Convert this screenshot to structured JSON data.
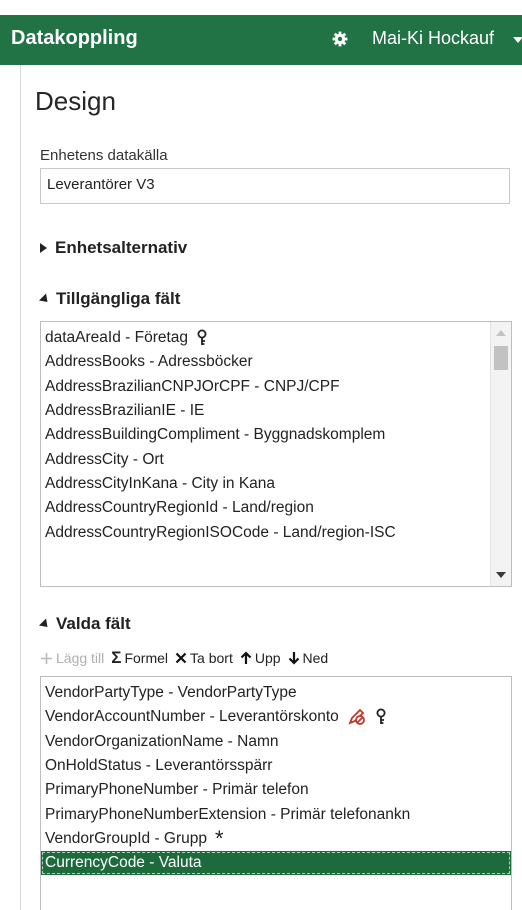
{
  "app": {
    "title": "Datakoppling",
    "user": "Mai-Ki Hockauf"
  },
  "page": {
    "heading": "Design"
  },
  "datasource": {
    "label": "Enhetens datakälla",
    "value": "Leverantörer V3"
  },
  "sections": {
    "entity_options": "Enhetsalternativ",
    "available_fields": "Tillgängliga fält",
    "selected_fields": "Valda fält"
  },
  "available_fields": [
    {
      "text": "dataAreaId - Företag",
      "icon": "key-icon"
    },
    {
      "text": "AddressBooks - Adressböcker"
    },
    {
      "text": "AddressBrazilianCNPJOrCPF - CNPJ/CPF"
    },
    {
      "text": "AddressBrazilianIE - IE"
    },
    {
      "text": "AddressBuildingCompliment - Byggnadskomplem"
    },
    {
      "text": "AddressCity - Ort"
    },
    {
      "text": "AddressCityInKana - City in Kana"
    },
    {
      "text": "AddressCountryRegionId - Land/region"
    },
    {
      "text": "AddressCountryRegionISOCode - Land/region-ISC"
    }
  ],
  "toolbar": {
    "add": "Lägg till",
    "formula": "Formel",
    "remove": "Ta bort",
    "up": "Upp",
    "down": "Ned"
  },
  "selected_fields": [
    {
      "text": "VendorPartyType - VendorPartyType"
    },
    {
      "text": "VendorAccountNumber - Leverantörskonto",
      "icons": [
        "no-edit-icon",
        "key-icon"
      ]
    },
    {
      "text": "VendorOrganizationName - Namn"
    },
    {
      "text": "OnHoldStatus - Leverantörsspärr"
    },
    {
      "text": "PrimaryPhoneNumber - Primär telefon"
    },
    {
      "text": "PrimaryPhoneNumberExtension - Primär telefonankn"
    },
    {
      "text": "VendorGroupId - Grupp",
      "icons": [
        "required-asterisk-icon"
      ]
    },
    {
      "text": "CurrencyCode - Valuta",
      "selected": true
    }
  ],
  "colors": {
    "brand": "#217346",
    "selected_row": "#1d6b3d",
    "no_edit": "#c0392b"
  }
}
